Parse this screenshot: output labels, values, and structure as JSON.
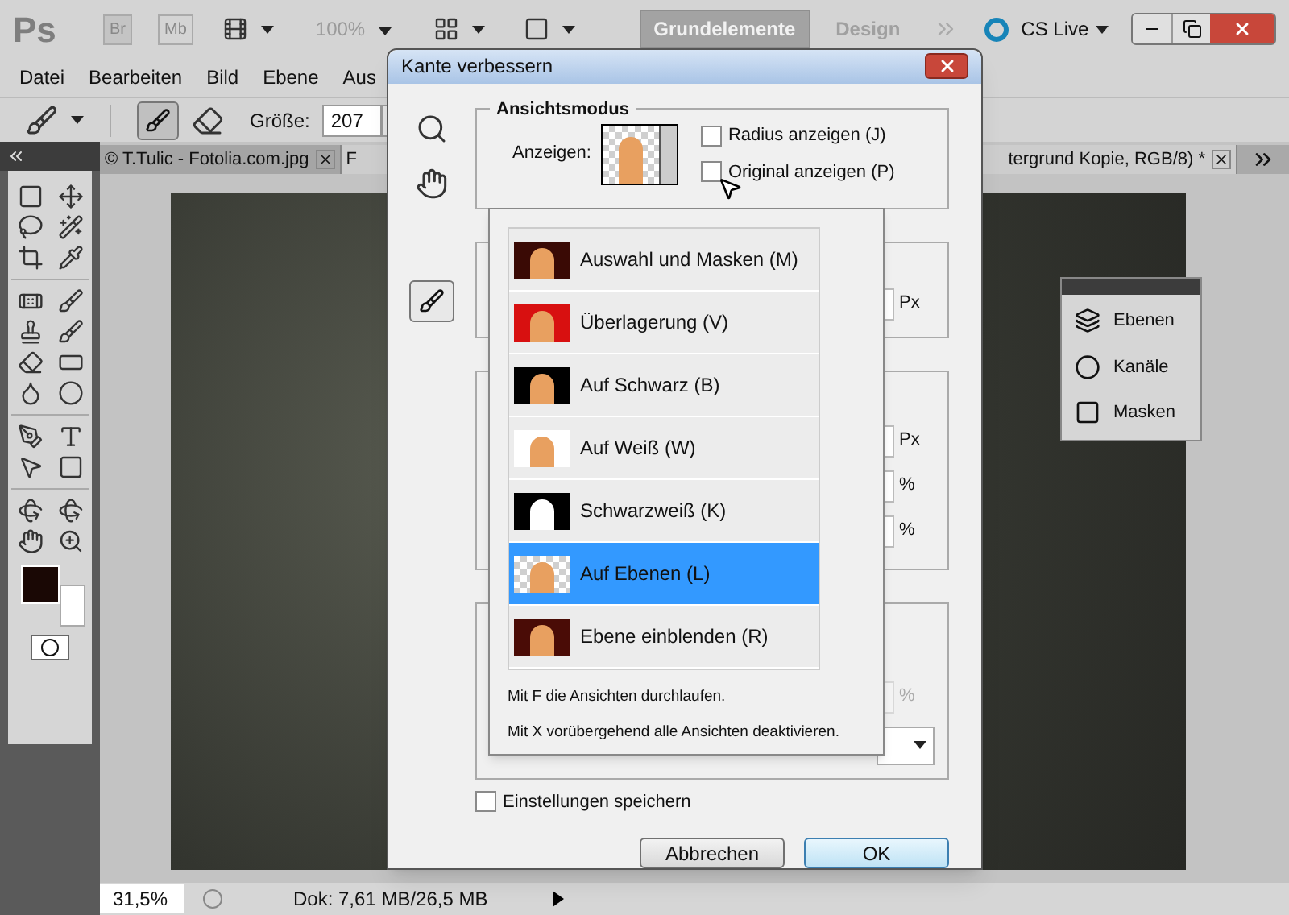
{
  "app_bar": {
    "logo": "Ps",
    "bridge": "Br",
    "mini_bridge": "Mb",
    "zoom": "100%",
    "workspaces": [
      {
        "label": "Grundelemente",
        "selected": true
      },
      {
        "label": "Design",
        "selected": false
      }
    ],
    "cs_live": "CS Live"
  },
  "menu": [
    "Datei",
    "Bearbeiten",
    "Bild",
    "Ebene",
    "Aus"
  ],
  "options_bar": {
    "size_label": "Größe:",
    "size_value": "207"
  },
  "doc_tabs": [
    {
      "label": "© T.Tulic - Fotolia.com.jpg",
      "selected": false
    },
    {
      "label_start": "F",
      "label_end": "tergrund Kopie, RGB/8) *",
      "selected": true
    }
  ],
  "panels": [
    {
      "label": "Ebenen",
      "kind": "layers"
    },
    {
      "label": "Kanäle",
      "kind": "channels"
    },
    {
      "label": "Masken",
      "kind": "masks"
    }
  ],
  "status_bar": {
    "zoom": "31,5%",
    "doc_size": "Dok: 7,61 MB/26,5 MB"
  },
  "dialog": {
    "title": "Kante verbessern",
    "view_mode": {
      "legend": "Ansichtsmodus",
      "show_label": "Anzeigen:",
      "options": [
        {
          "label": "Radius anzeigen (J)",
          "checked": false
        },
        {
          "label": "Original anzeigen (P)",
          "checked": false
        }
      ]
    },
    "units": [
      {
        "label": "Px",
        "disabled": false
      },
      {
        "label": "Px",
        "disabled": false
      },
      {
        "label": "%",
        "disabled": false
      },
      {
        "label": "%",
        "disabled": false
      },
      {
        "label": "%",
        "disabled": true
      }
    ],
    "view_menu": {
      "items": [
        {
          "label": "Auswahl und Masken (M)",
          "kind": "marching",
          "selected": false
        },
        {
          "label": "Überlagerung (V)",
          "kind": "overlay",
          "selected": false
        },
        {
          "label": "Auf Schwarz (B)",
          "kind": "black",
          "selected": false
        },
        {
          "label": "Auf Weiß (W)",
          "kind": "white",
          "selected": false
        },
        {
          "label": "Schwarzweiß (K)",
          "kind": "bw",
          "selected": false
        },
        {
          "label": "Auf Ebenen (L)",
          "kind": "layers",
          "selected": true
        },
        {
          "label": "Ebene einblenden (R)",
          "kind": "reveal",
          "selected": false
        }
      ],
      "hints": [
        "Mit F die Ansichten durchlaufen.",
        "Mit X vorübergehend alle Ansichten deaktivieren."
      ]
    },
    "save_settings": {
      "label": "Einstellungen speichern",
      "checked": false
    },
    "buttons": [
      {
        "label": "Abbrechen",
        "default": false
      },
      {
        "label": "OK",
        "default": true
      }
    ]
  }
}
